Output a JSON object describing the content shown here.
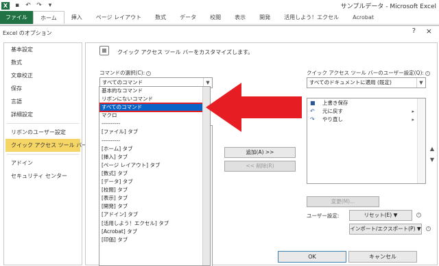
{
  "titlebar": {
    "app_icon": "X",
    "save_icon": "save-icon",
    "undo_icon": "undo-icon",
    "redo_icon": "redo-icon",
    "customize_icon": "customize-qat-icon",
    "title": "サンプルデータ - Microsoft Excel"
  },
  "ribbon": {
    "tabs": [
      "ファイル",
      "ホーム",
      "挿入",
      "ページ レイアウト",
      "数式",
      "データ",
      "校閲",
      "表示",
      "開発",
      "活用しよう！エクセル",
      "Acrobat"
    ]
  },
  "dialog": {
    "title": "Excel のオプション",
    "help": "?",
    "close": "×"
  },
  "nav": {
    "items": [
      "基本設定",
      "数式",
      "文章校正",
      "保存",
      "言語",
      "詳細設定",
      "リボンのユーザー設定",
      "クイック アクセス ツール バー",
      "アドイン",
      "セキュリティ センター"
    ]
  },
  "main": {
    "header": "クイック アクセス ツール バーをカスタマイズします。",
    "commands_label": "コマンドの選択(C):",
    "commands_value": "すべてのコマンド",
    "user_settings_label": "クイック アクセス ツール バーのユーザー設定(Q):",
    "user_settings_value": "すべてのドキュメントに適用 (既定)",
    "dropdown_items": [
      "基本的なコマンド",
      "リボンにないコマンド",
      "すべてのコマンド",
      "マクロ",
      "----------",
      "[ファイル] タブ",
      "----------",
      "[ホーム] タブ",
      "[挿入] タブ",
      "[ページ レイアウト] タブ",
      "[数式] タブ",
      "[データ] タブ",
      "[校閲] タブ",
      "[表示] タブ",
      "[開発] タブ",
      "[アドイン] タブ",
      "[活用しよう！エクセル] タブ",
      "[Acrobat] タブ",
      "[印価] タブ"
    ],
    "selected_index": 2,
    "qat_items": [
      {
        "icon": "save-icon",
        "label": "上書き保存",
        "sub": ""
      },
      {
        "icon": "undo-icon",
        "label": "元に戻す",
        "sub": "▸"
      },
      {
        "icon": "redo-icon",
        "label": "やり直し",
        "sub": "▸"
      }
    ],
    "add_button": "追加(A) >>",
    "remove_button": "<< 削除(R)",
    "modify_button": "変更(M)...",
    "user_settings_text": "ユーザー設定:",
    "reset_button": "リセット(E) ▼",
    "import_export_button": "インポート/エクスポート(P) ▼",
    "up_icon": "▲",
    "down_icon": "▼"
  },
  "footer": {
    "ok": "OK",
    "cancel": "キャンセル"
  },
  "colors": {
    "excel_green": "#217346",
    "selection_blue": "#0a64c8",
    "highlight_red": "#e02020",
    "nav_selected": "#f5d566"
  }
}
